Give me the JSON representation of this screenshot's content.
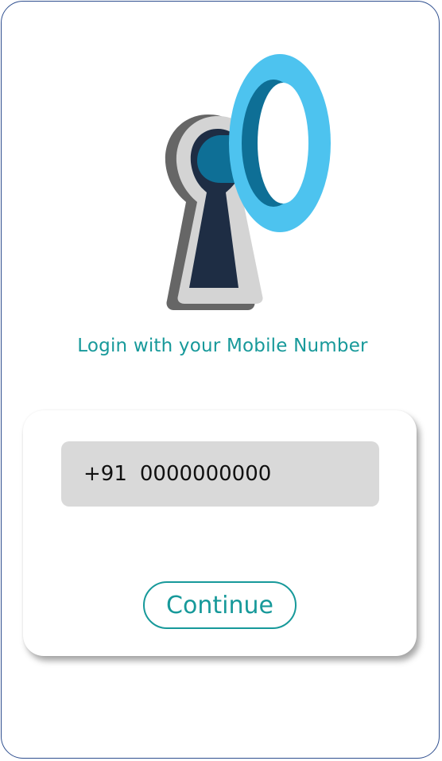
{
  "login": {
    "subtitle": "Login with your Mobile Number",
    "country_code": "+91",
    "phone_value": "0000000000",
    "continue_label": "Continue"
  },
  "colors": {
    "accent": "#17999a",
    "frame_border": "#2f4f8f",
    "field_bg": "#d9d9d9",
    "ring": "#4dc3ef",
    "keyhole_dark": "#1e2d44"
  },
  "icons": {
    "hero": "keyhole-key-icon"
  }
}
